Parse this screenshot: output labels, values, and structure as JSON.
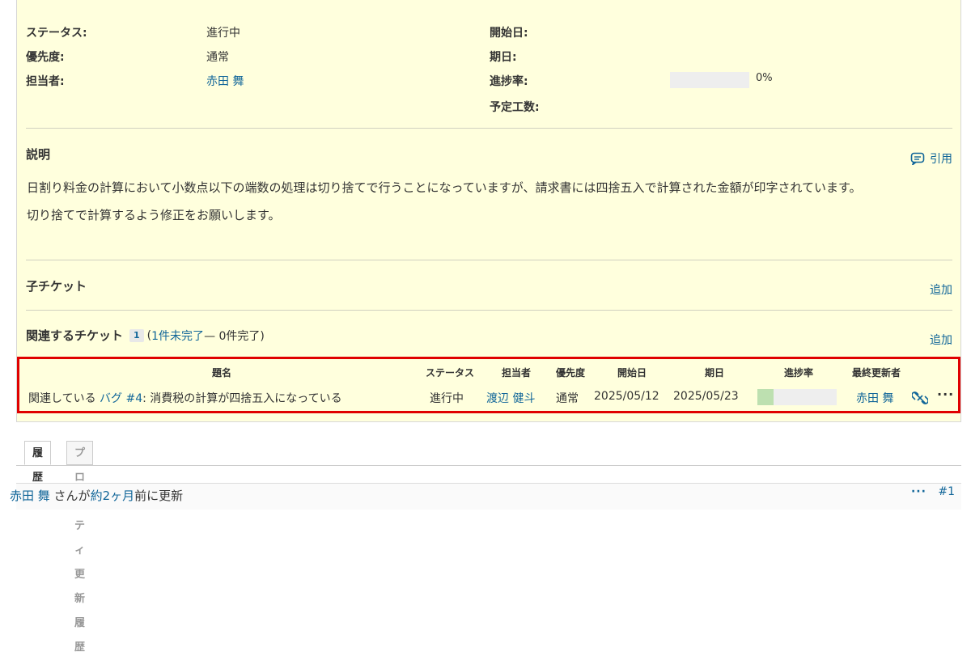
{
  "attributes": {
    "status_label": "ステータス:",
    "status_value": "進行中",
    "priority_label": "優先度:",
    "priority_value": "通常",
    "assignee_label": "担当者:",
    "assignee_value": "赤田 舞",
    "start_date_label": "開始日:",
    "due_date_label": "期日:",
    "progress_label": "進捗率:",
    "progress_value": "0%",
    "progress_fraction": 0,
    "estimated_label": "予定工数:"
  },
  "description": {
    "title": "説明",
    "quote_label": "引用",
    "paragraph1": "日割り料金の計算において小数点以下の端数の処理は切り捨てで行うことになっていますが、請求書には四捨五入で計算された金額が印字されています。",
    "paragraph2": "切り捨てで計算するよう修正をお願いします。"
  },
  "subtasks": {
    "title": "子チケット",
    "add_label": "追加"
  },
  "relations": {
    "title": "関連するチケット",
    "count": "1",
    "open_paren": "(",
    "open_link": "1件未完了",
    "separator": " — 0件完了)",
    "add_label": "追加",
    "headers": {
      "subject": "題名",
      "status": "ステータス",
      "assignee": "担当者",
      "priority": "優先度",
      "start": "開始日",
      "due": "期日",
      "progress": "進捗率",
      "updated_by": "最終更新者"
    },
    "row": {
      "relation": "関連している",
      "issue_link": "バグ #4",
      "subject": ": 消費税の計算が四捨五入になっている",
      "status": "進行中",
      "assignee": "渡辺 健斗",
      "priority": "通常",
      "start": "2025/05/12",
      "due": "2025/05/23",
      "progress_fraction": 0.2,
      "updated_by": "赤田 舞",
      "more_label": "···"
    }
  },
  "tabs": {
    "history": "履歴",
    "property_history": "プロパティ更新履歴"
  },
  "journal": {
    "author": "赤田 舞",
    "text_middle": " さんが",
    "time_link": "約2ヶ月",
    "text_end": "前に更新",
    "more_label": "···",
    "number": "#1"
  },
  "colors": {
    "issue_bg": "#ffffdd",
    "link": "#116699",
    "highlight_border": "#e00000",
    "progress_done": "#bde0b0"
  }
}
